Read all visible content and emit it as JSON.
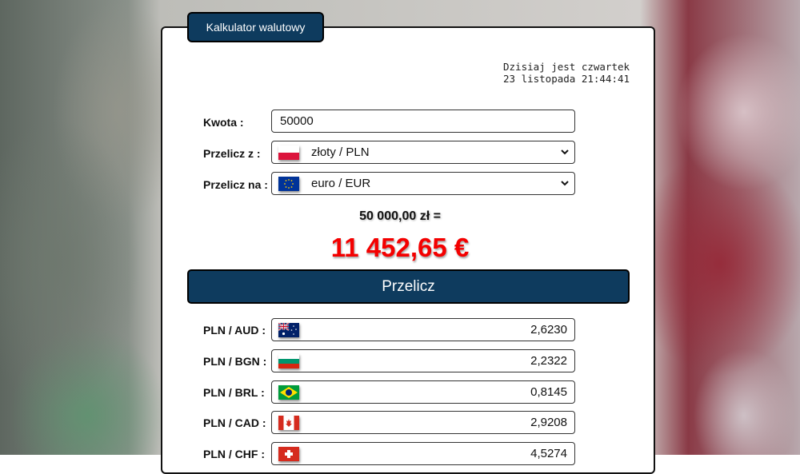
{
  "tab_title": "Kalkulator walutowy",
  "date_line1": "Dzisiaj jest czwartek",
  "date_line2": "23 listopada 21:44:41",
  "form": {
    "amount_label": "Kwota :",
    "amount_value": "50000",
    "from_label": "Przelicz z :",
    "from_value": "złoty / PLN",
    "to_label": "Przelicz na :",
    "to_value": "euro / EUR"
  },
  "conversion": {
    "from_amount": "50 000,00  zł =",
    "result": "11 452,65  €"
  },
  "convert_button": "Przelicz",
  "rates": [
    {
      "pair": "PLN / AUD :",
      "flag": "australia-flag",
      "value": "2,6230"
    },
    {
      "pair": "PLN / BGN :",
      "flag": "bulgaria-flag",
      "value": "2,2322"
    },
    {
      "pair": "PLN / BRL :",
      "flag": "brazil-flag",
      "value": "0,8145"
    },
    {
      "pair": "PLN / CAD :",
      "flag": "canada-flag",
      "value": "2,9208"
    },
    {
      "pair": "PLN / CHF :",
      "flag": "switzerland-flag",
      "value": "4,5274"
    }
  ],
  "colors": {
    "accent": "#0e3b5e",
    "result": "#f40000"
  }
}
